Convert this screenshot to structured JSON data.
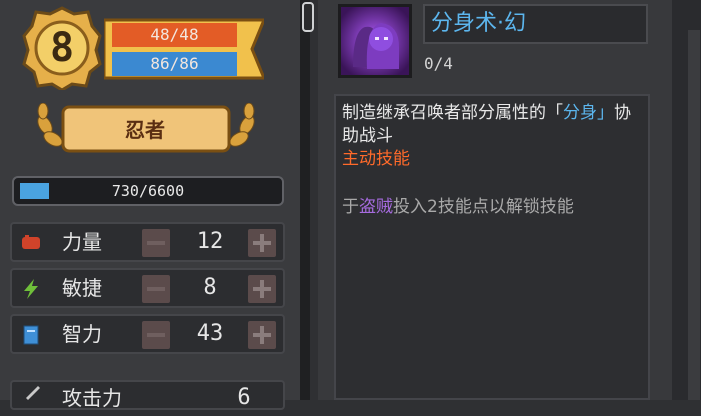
{
  "character": {
    "level": "8",
    "hp": "48/48",
    "mp": "86/86",
    "class_title": "忍者",
    "xp": "730/6600",
    "xp_fraction": 0.11
  },
  "stats": [
    {
      "label": "力量",
      "value": "12",
      "icon": "fist-icon"
    },
    {
      "label": "敏捷",
      "value": "8",
      "icon": "lightning-icon"
    },
    {
      "label": "智力",
      "value": "43",
      "icon": "book-icon"
    }
  ],
  "stat_cut": {
    "label": "攻击力",
    "value": "6"
  },
  "skill": {
    "name": "分身术·幻",
    "level": "0/4",
    "desc_part1": "制造继承召唤者部分属性的「",
    "desc_highlight": "分身」",
    "desc_part2": "协助战斗",
    "type": "主动技能",
    "unlock_prefix": "于",
    "unlock_class": "盗贼",
    "unlock_suffix": "投入2技能点以解锁技能"
  },
  "colors": {
    "hp": "#e35c26",
    "mp": "#3b89d1",
    "skill_name": "#5cb6ee",
    "active": "#ff6a2a"
  }
}
